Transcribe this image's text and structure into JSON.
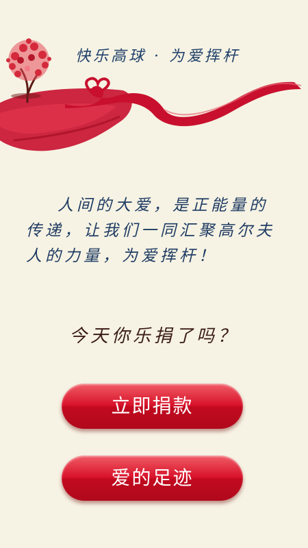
{
  "header": {
    "title": "快乐高球 · 为爱挥杆"
  },
  "intro": {
    "text": "人间的大爱，是正能量的传递，让我们一同汇聚高尔夫人的力量，为爱挥杆！"
  },
  "question": {
    "text": "今天你乐捐了吗？"
  },
  "buttons": {
    "donate_label": "立即捐款",
    "trace_label": "爱的足迹"
  },
  "colors": {
    "background": "#f6f3e4",
    "title": "#1e3f69",
    "button_red": "#d8122a",
    "ribbon_red": "#c8102e"
  },
  "icons": {
    "tree": "heart-tree-icon",
    "ribbon": "heart-ribbon-icon"
  }
}
